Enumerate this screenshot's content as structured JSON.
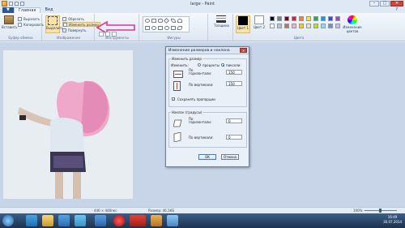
{
  "window": {
    "title": "large - Paint",
    "minimize": "–",
    "maximize": "□",
    "close": "✕"
  },
  "tabs": [
    "▼",
    "Главная",
    "Вид"
  ],
  "help": "?",
  "ribbon": {
    "clipboard": {
      "paste": "Вставить",
      "cut": "Вырезать",
      "copy": "Копировать",
      "label": "Буфер обмена"
    },
    "image": {
      "select": "Выделить",
      "crop": "Обрезать",
      "resize": "Изменить размер",
      "rotate": "Повернуть",
      "label": "Изображения"
    },
    "tools": {
      "label": "Инструменты"
    },
    "brushes": {
      "label": "Кисти"
    },
    "shapes": {
      "label": "Фигуры"
    },
    "size": {
      "label": "Толщина"
    },
    "colors": {
      "color1": "Цвет 1",
      "color2": "Цвет 2",
      "edit": "Изменение цветов",
      "label": "Цвета"
    }
  },
  "palette": [
    "#000000",
    "#7f7f7f",
    "#880015",
    "#ed1c24",
    "#ff7f27",
    "#fff200",
    "#22b14c",
    "#00a2e8",
    "#3f48cc",
    "#a349a4",
    "#ffffff",
    "#c3c3c3",
    "#b97a57",
    "#ffaec9",
    "#ffc90e",
    "#efe4b0",
    "#b5e61d",
    "#99d9ea",
    "#7092be",
    "#c8bfe7"
  ],
  "dialog": {
    "title": "Изменение размеров и наклона",
    "close": "✕",
    "resize_legend": "Изменить размер",
    "by_label": "Изменить:",
    "percent": "проценты",
    "pixels": "пиксели",
    "horizontal": "По горизонтали:",
    "vertical": "По вертикали:",
    "h_value": "150",
    "v_value": "150",
    "keep_ratio": "Сохранять пропорции",
    "skew_legend": "Наклон (градусы)",
    "skew_h": "По горизонтали:",
    "skew_v": "По вертикали:",
    "skew_h_value": "0",
    "skew_v_value": "0",
    "ok": "ОК",
    "cancel": "Отмена"
  },
  "status": {
    "size": "446 × 446пкс",
    "file": "Размер: 46,1КБ",
    "zoom": "100%"
  },
  "clock": {
    "time": "16:49",
    "date": "30.07.2014"
  },
  "colors": {
    "accent": "#2b5797",
    "annotation": "#e0368f"
  }
}
